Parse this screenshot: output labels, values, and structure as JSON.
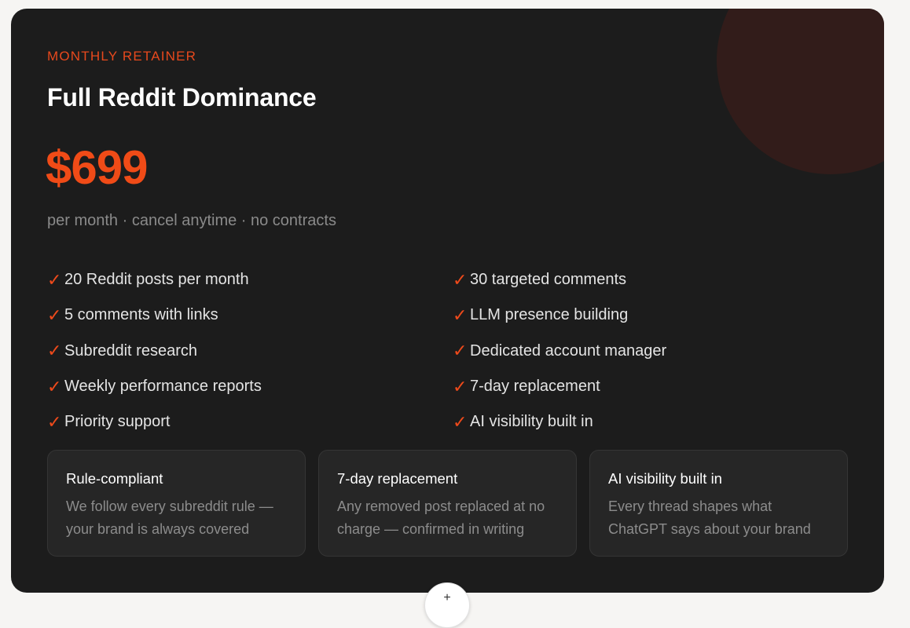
{
  "card": {
    "eyebrow": "MONTHLY RETAINER",
    "title": "Full Reddit Dominance",
    "price": "$699",
    "subtitle": "per month · cancel anytime · no contracts",
    "accent_color": "#f04b17",
    "features": [
      {
        "icon": "checkmark-icon",
        "label": "20 Reddit posts per month"
      },
      {
        "icon": "checkmark-icon",
        "label": "30 targeted comments"
      },
      {
        "icon": "checkmark-icon",
        "label": "5 comments with links"
      },
      {
        "icon": "checkmark-icon",
        "label": "LLM presence building"
      },
      {
        "icon": "checkmark-icon",
        "label": "Subreddit research"
      },
      {
        "icon": "checkmark-icon",
        "label": "Dedicated account manager"
      },
      {
        "icon": "checkmark-icon",
        "label": "Weekly performance reports"
      },
      {
        "icon": "checkmark-icon",
        "label": "7-day replacement"
      },
      {
        "icon": "checkmark-icon",
        "label": "Priority support"
      },
      {
        "icon": "checkmark-icon",
        "label": "AI visibility built in"
      }
    ],
    "boxes": [
      {
        "title": "Rule-compliant",
        "desc_line1": "We follow every subreddit rule —",
        "desc_line2": "your brand is always covered"
      },
      {
        "title": "7-day replacement",
        "desc_line1": "Any removed post replaced at no",
        "desc_line2": "charge — confirmed in writing"
      },
      {
        "title": "AI visibility built in",
        "desc_line1": "Every thread shapes what",
        "desc_line2": "ChatGPT says about your brand"
      }
    ]
  },
  "floating_button": {
    "icon": "plus-icon",
    "glyph": "+"
  }
}
